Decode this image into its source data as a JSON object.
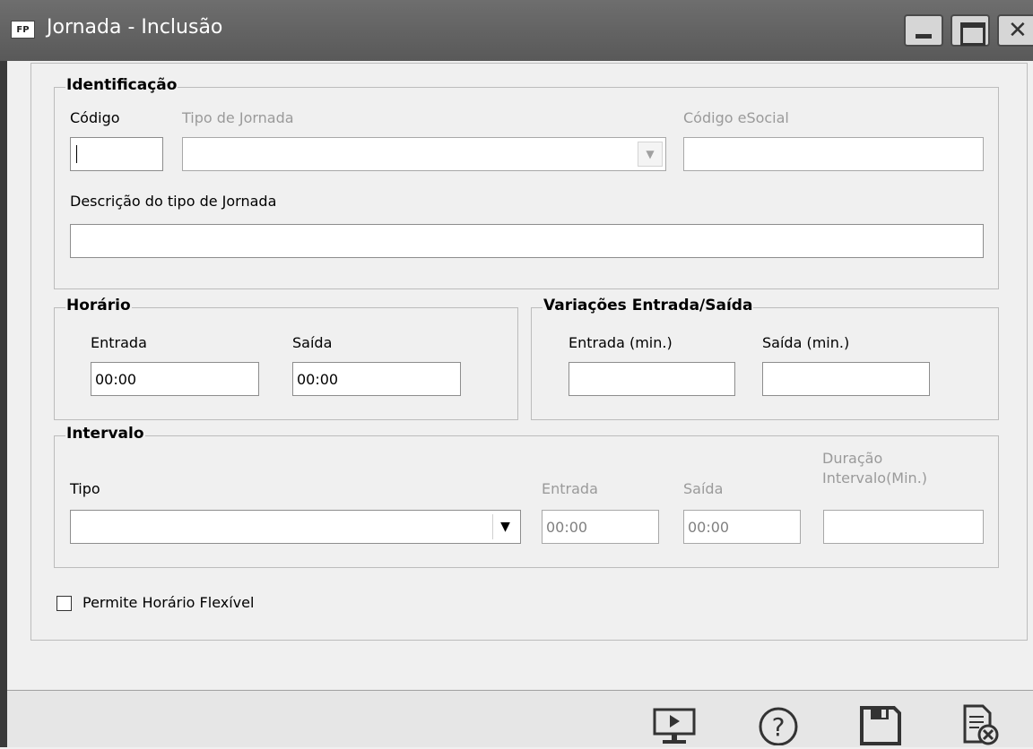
{
  "window": {
    "icon_text": "FP",
    "title": "Jornada - Inclusão"
  },
  "identificacao": {
    "title": "Identificação",
    "codigo_label": "Código",
    "codigo_value": "",
    "tipo_label": "Tipo de Jornada",
    "tipo_value": "",
    "esocial_label": "Código eSocial",
    "esocial_value": "",
    "descricao_label": "Descrição do tipo de Jornada",
    "descricao_value": ""
  },
  "horario": {
    "title": "Horário",
    "entrada_label": "Entrada",
    "entrada_value": "00:00",
    "saida_label": "Saída",
    "saida_value": "00:00"
  },
  "variacoes": {
    "title": "Variações Entrada/Saída",
    "entrada_label": "Entrada (min.)",
    "entrada_value": "",
    "saida_label": "Saída (min.)",
    "saida_value": ""
  },
  "intervalo": {
    "title": "Intervalo",
    "tipo_label": "Tipo",
    "tipo_value": "",
    "entrada_label": "Entrada",
    "entrada_value": "00:00",
    "saida_label": "Saída",
    "saida_value": "00:00",
    "duracao_label_line1": "Duração",
    "duracao_label_line2": "Intervalo(Min.)",
    "duracao_value": ""
  },
  "flexivel": {
    "label": "Permite Horário Flexível",
    "checked": false
  },
  "footer_icons": [
    "preview-icon",
    "help-icon",
    "save-icon",
    "cancel-document-icon"
  ]
}
